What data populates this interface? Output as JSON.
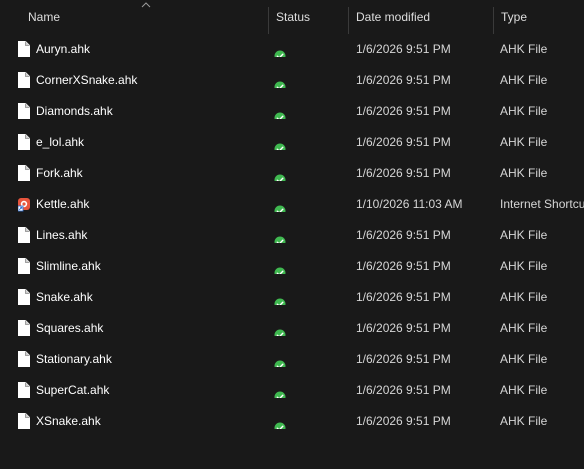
{
  "columns": {
    "name": "Name",
    "status": "Status",
    "date": "Date modified",
    "type": "Type"
  },
  "sort_icon": "chevron-up-icon",
  "status_icon": "sync-check-icon",
  "status_color": "#3fb950",
  "rows": [
    {
      "name": "Auryn.ahk",
      "date": "1/6/2026 9:51 PM",
      "type": "AHK File",
      "icon": "file-icon"
    },
    {
      "name": "CornerXSnake.ahk",
      "date": "1/6/2026 9:51 PM",
      "type": "AHK File",
      "icon": "file-icon"
    },
    {
      "name": "Diamonds.ahk",
      "date": "1/6/2026 9:51 PM",
      "type": "AHK File",
      "icon": "file-icon"
    },
    {
      "name": "e_lol.ahk",
      "date": "1/6/2026 9:51 PM",
      "type": "AHK File",
      "icon": "file-icon"
    },
    {
      "name": "Fork.ahk",
      "date": "1/6/2026 9:51 PM",
      "type": "AHK File",
      "icon": "file-icon"
    },
    {
      "name": "Kettle.ahk",
      "date": "1/10/2026 11:03 AM",
      "type": "Internet Shortcut",
      "icon": "internet-shortcut-icon"
    },
    {
      "name": "Lines.ahk",
      "date": "1/6/2026 9:51 PM",
      "type": "AHK File",
      "icon": "file-icon"
    },
    {
      "name": "Slimline.ahk",
      "date": "1/6/2026 9:51 PM",
      "type": "AHK File",
      "icon": "file-icon"
    },
    {
      "name": "Snake.ahk",
      "date": "1/6/2026 9:51 PM",
      "type": "AHK File",
      "icon": "file-icon"
    },
    {
      "name": "Squares.ahk",
      "date": "1/6/2026 9:51 PM",
      "type": "AHK File",
      "icon": "file-icon"
    },
    {
      "name": "Stationary.ahk",
      "date": "1/6/2026 9:51 PM",
      "type": "AHK File",
      "icon": "file-icon"
    },
    {
      "name": "SuperCat.ahk",
      "date": "1/6/2026 9:51 PM",
      "type": "AHK File",
      "icon": "file-icon"
    },
    {
      "name": "XSnake.ahk",
      "date": "1/6/2026 9:51 PM",
      "type": "AHK File",
      "icon": "file-icon"
    }
  ]
}
